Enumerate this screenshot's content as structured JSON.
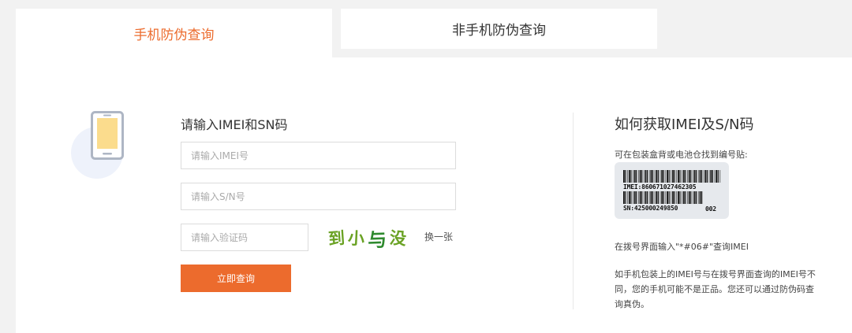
{
  "tabs": {
    "phone": "手机防伪查询",
    "non_phone": "非手机防伪查询"
  },
  "form": {
    "title": "请输入IMEI和SN码",
    "imei_placeholder": "请输入IMEI号",
    "sn_placeholder": "请输入S/N号",
    "code_placeholder": "请输入验证码",
    "captcha_chars": [
      "到",
      "小",
      "与",
      "没"
    ],
    "refresh_label": "换一张",
    "submit_label": "立即查询"
  },
  "help": {
    "title": "如何获取IMEI及S/N码",
    "p1": "可在包装盒背或电池仓找到编号贴:",
    "label_imei": "IMEI:860671027462305",
    "label_sn": "SN:425000249850",
    "label_code": "002",
    "p2": "在拨号界面输入\"*#06#\"查询IMEI",
    "p3": "如手机包装上的IMEI号与在拨号界面查询的IMEI号不同，您的手机可能不是正品。您还可以通过防伪码查询真伪。"
  },
  "colors": {
    "accent": "#ec6b2d",
    "captcha_green": "#6aa224"
  }
}
